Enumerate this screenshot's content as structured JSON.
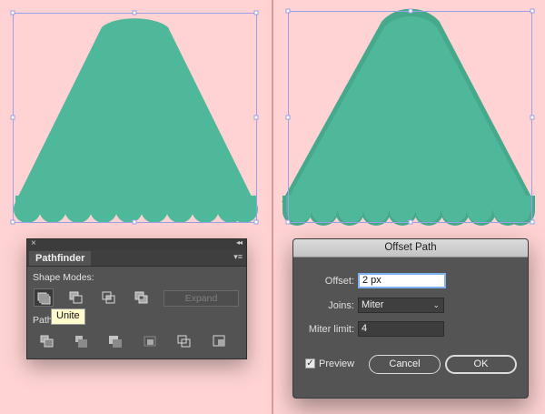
{
  "colors": {
    "background": "#ffd3d3",
    "shape_fill": "#50b89a",
    "selection_outline": "#9aa0e6"
  },
  "pathfinder": {
    "close_glyph": "×",
    "collapse_glyph": "◂◂",
    "tab_label": "Pathfinder",
    "menu_glyph": "▾≡",
    "shape_modes_label": "Shape Modes:",
    "expand_label": "Expand",
    "pathfinders_label": "Path",
    "tooltip": "Unite",
    "shape_mode_buttons": [
      "unite-icon",
      "minus-front-icon",
      "intersect-icon",
      "exclude-icon"
    ],
    "pathfinder_buttons": [
      "divide-icon",
      "trim-icon",
      "merge-icon",
      "crop-icon",
      "outline-icon",
      "minus-back-icon"
    ]
  },
  "offset_path": {
    "title": "Offset Path",
    "offset_label": "Offset:",
    "offset_value": "2 px",
    "joins_label": "Joins:",
    "joins_value": "Miter",
    "miter_limit_label": "Miter limit:",
    "miter_limit_value": "4",
    "preview_label": "Preview",
    "preview_checked": true,
    "cancel_label": "Cancel",
    "ok_label": "OK"
  }
}
